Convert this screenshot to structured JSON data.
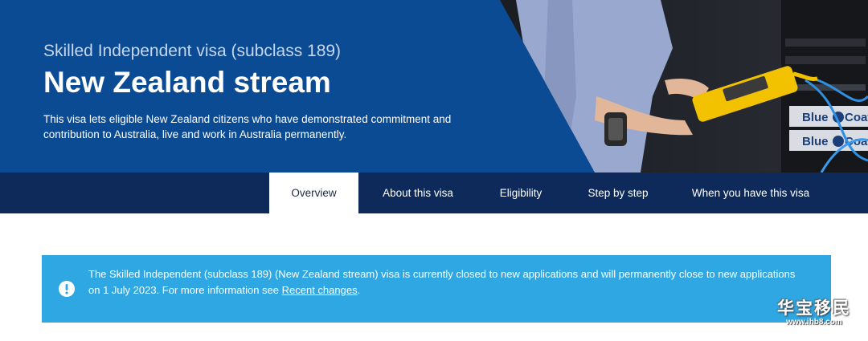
{
  "hero": {
    "eyebrow": "Skilled Independent visa (subclass 189)",
    "title": "New Zealand stream",
    "description": "This visa lets eligible New Zealand citizens who have demonstrated commitment and contribution to Australia, live and work in Australia permanently.",
    "photo": {
      "subject": "technician holding yellow cable tester beside server rack",
      "labels": [
        "Blue Coat",
        "Blue Coat"
      ]
    }
  },
  "tabs": [
    {
      "label": "Overview",
      "active": true
    },
    {
      "label": "About this visa",
      "active": false
    },
    {
      "label": "Eligibility",
      "active": false
    },
    {
      "label": "Step by step",
      "active": false
    },
    {
      "label": "When you have this visa",
      "active": false
    }
  ],
  "alert": {
    "icon": "exclamation-circle-icon",
    "text": "The Skilled Independent (subclass 189) (New Zealand stream) visa is currently closed to new applications and will permanently close to new applications on 1 July 2023. For more information see ",
    "link": "Recent changes",
    "suffix": "."
  },
  "watermark": {
    "main": "华宝移民",
    "sub": "www.ihb8.com"
  },
  "colors": {
    "hero_bg": "#0a4b94",
    "tabs_bg": "#0e2a5a",
    "alert_bg": "#2fa7e3",
    "eyebrow": "#c7d7ee"
  }
}
